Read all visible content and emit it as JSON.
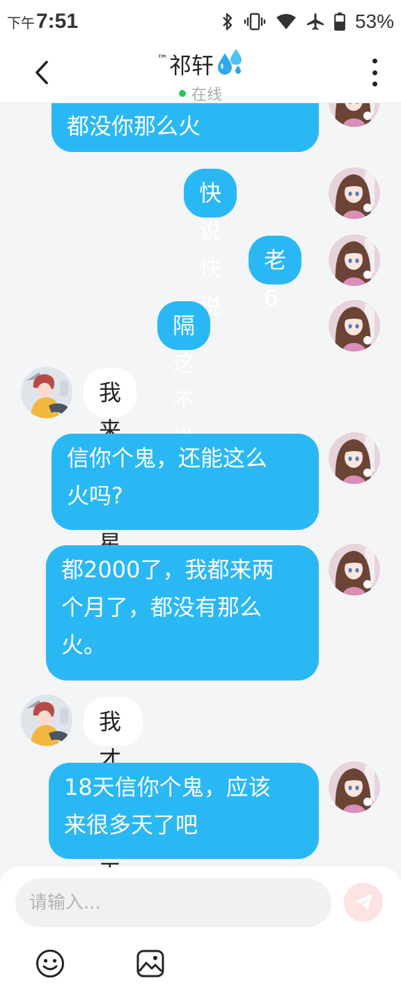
{
  "status_bar": {
    "ampm": "下午",
    "time": "7:51",
    "battery": "53%",
    "icons": [
      "bluetooth-icon",
      "vibrate-icon",
      "wifi-icon",
      "airplane-icon",
      "battery-icon"
    ]
  },
  "header": {
    "tm": "™",
    "name": "祁轩",
    "emoji": "💦",
    "status": "在线",
    "back_icon": "back-chevron-icon",
    "more_icon": "more-vertical-icon"
  },
  "messages": [
    {
      "direction": "out",
      "text": "都没你那么火"
    },
    {
      "direction": "out",
      "text": "快说快说"
    },
    {
      "direction": "out",
      "text": "老6"
    },
    {
      "direction": "out",
      "text": "隔这不说话"
    },
    {
      "direction": "in",
      "text": "我来三个星期不到"
    },
    {
      "direction": "out",
      "text": "信你个鬼，还能这么\n火吗?"
    },
    {
      "direction": "out",
      "text": "都2000了，我都来两\n个月了，都没有那么\n火。"
    },
    {
      "direction": "in",
      "text": "我才来18天"
    },
    {
      "direction": "out",
      "text": "18天信你个鬼，应该\n来很多天了吧"
    }
  ],
  "input": {
    "placeholder": "请输入...",
    "send_icon": "send-icon",
    "tools": [
      "emoji-icon",
      "image-icon"
    ]
  },
  "colors": {
    "outgoing_bubble": "#2ab8f5",
    "incoming_bubble": "#ffffff",
    "background": "#f4f5f7",
    "online": "#2fc25b",
    "send_button": "#fde3e2"
  }
}
